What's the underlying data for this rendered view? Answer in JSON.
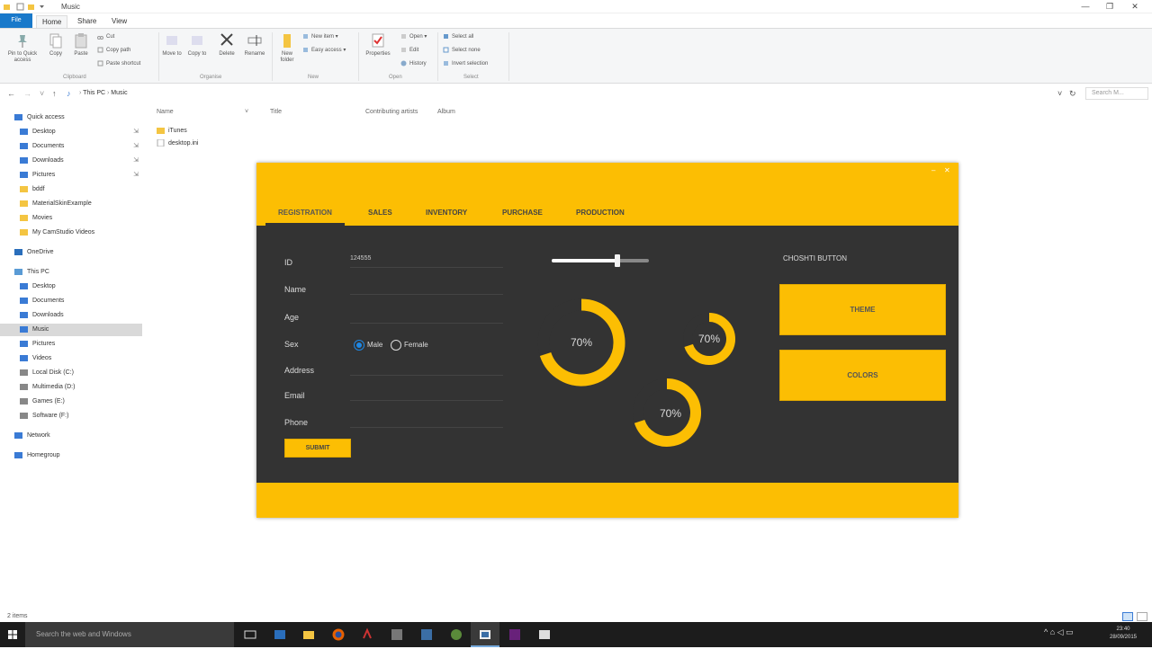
{
  "window": {
    "title": "Music",
    "controls": [
      "—",
      "❐",
      "✕"
    ]
  },
  "ribbon_tabs": [
    {
      "label": "File"
    },
    {
      "label": "Home"
    },
    {
      "label": "Share"
    },
    {
      "label": "View"
    }
  ],
  "ribbon": {
    "clipboard": {
      "pin": "Pin to Quick access",
      "copy": "Copy",
      "paste": "Paste",
      "cut": "Cut",
      "copy_path": "Copy path",
      "paste_shortcut": "Paste shortcut",
      "group": "Clipboard"
    },
    "organise": {
      "move_to": "Move to",
      "copy_to": "Copy to",
      "delete": "Delete",
      "rename": "Rename",
      "group": "Organise"
    },
    "new": {
      "new_folder": "New folder",
      "new_item": "New item",
      "easy_access": "Easy access",
      "group": "New"
    },
    "open": {
      "properties": "Properties",
      "open": "Open",
      "edit": "Edit",
      "history": "History",
      "group": "Open"
    },
    "select": {
      "select_all": "Select all",
      "select_none": "Select none",
      "invert": "Invert selection",
      "group": "Select"
    }
  },
  "address": {
    "crumb1": "This PC",
    "crumb2": "Music",
    "search_placeholder": "Search M..."
  },
  "nav": {
    "quick_access": "Quick access",
    "qa_items": [
      "Desktop",
      "Documents",
      "Downloads",
      "Pictures",
      "bddf",
      "MaterialSkinExample",
      "Movies",
      "My CamStudio Videos"
    ],
    "onedrive": "OneDrive",
    "thispc": "This PC",
    "pc_items": [
      "Desktop",
      "Documents",
      "Downloads",
      "Music",
      "Pictures",
      "Videos",
      "Local Disk (C:)",
      "Multimedia (D:)",
      "Games (E:)",
      "Software (F:)"
    ],
    "network": "Network",
    "homegroup": "Homegroup"
  },
  "columns": {
    "name": "Name",
    "title": "Title",
    "artists": "Contributing artists",
    "album": "Album"
  },
  "files": [
    "iTunes",
    "desktop.ini"
  ],
  "status": {
    "items": "2 items"
  },
  "app": {
    "tabs": [
      "REGISTRATION",
      "SALES",
      "INVENTORY",
      "PURCHASE",
      "PRODUCTION"
    ],
    "labels": [
      "ID",
      "Name",
      "Age",
      "Sex",
      "Address",
      "Email",
      "Phone"
    ],
    "id_value": "124555",
    "sex": {
      "male": "Male",
      "female": "Female"
    },
    "submit": "SUBMIT",
    "slider_value": 0.68,
    "gauges": [
      {
        "label": "70%",
        "value": 0.7
      },
      {
        "label": "70%",
        "value": 0.7
      },
      {
        "label": "70%",
        "value": 0.7
      }
    ],
    "chosti_label": "CHOSHTI BUTTON",
    "theme_button": "THEME",
    "colors_button": "COLORS",
    "accent_color": "#fcbe03",
    "body_color": "#333333"
  },
  "taskbar": {
    "search_placeholder": "Search the web and Windows",
    "time": "23:40",
    "date": "28/09/2015"
  }
}
